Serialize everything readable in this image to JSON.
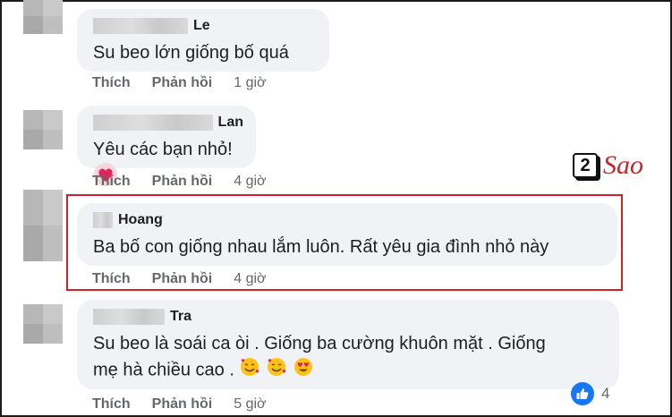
{
  "comments": [
    {
      "name": "Le",
      "text": "Su beo lớn giống bố quá",
      "like": "Thích",
      "reply": "Phản hồi",
      "time": "1 giờ"
    },
    {
      "name": "Lan",
      "text": "Yêu các bạn nhỏ!",
      "like": "Thích",
      "reply": "Phản hồi",
      "time": "4 giờ"
    },
    {
      "name": "Hoang",
      "text": "Ba bố con giống nhau lắm luôn. Rất yêu gia đình nhỏ này",
      "like": "Thích",
      "reply": "Phản hồi",
      "time": "4 giờ"
    },
    {
      "name": "Tra",
      "text_line1": "Su beo là soái ca òi . Giống ba cường khuôn mặt . Giống",
      "text_line2": "mẹ hà chiều cao .",
      "like": "Thích",
      "reply": "Phản hồi",
      "time": "5 giờ",
      "reaction_count": "4"
    }
  ],
  "watermark": {
    "digit": "2",
    "word": "Sao"
  },
  "icons": {
    "love": "heart-face-icon",
    "hearts_face": "smiling-face-with-hearts-icon",
    "heart_eyes": "heart-eyes-icon",
    "like": "like-icon"
  },
  "colors": {
    "highlight": "#d0212a",
    "bubble": "#f0f2f5",
    "like_blue": "#1877f2"
  }
}
